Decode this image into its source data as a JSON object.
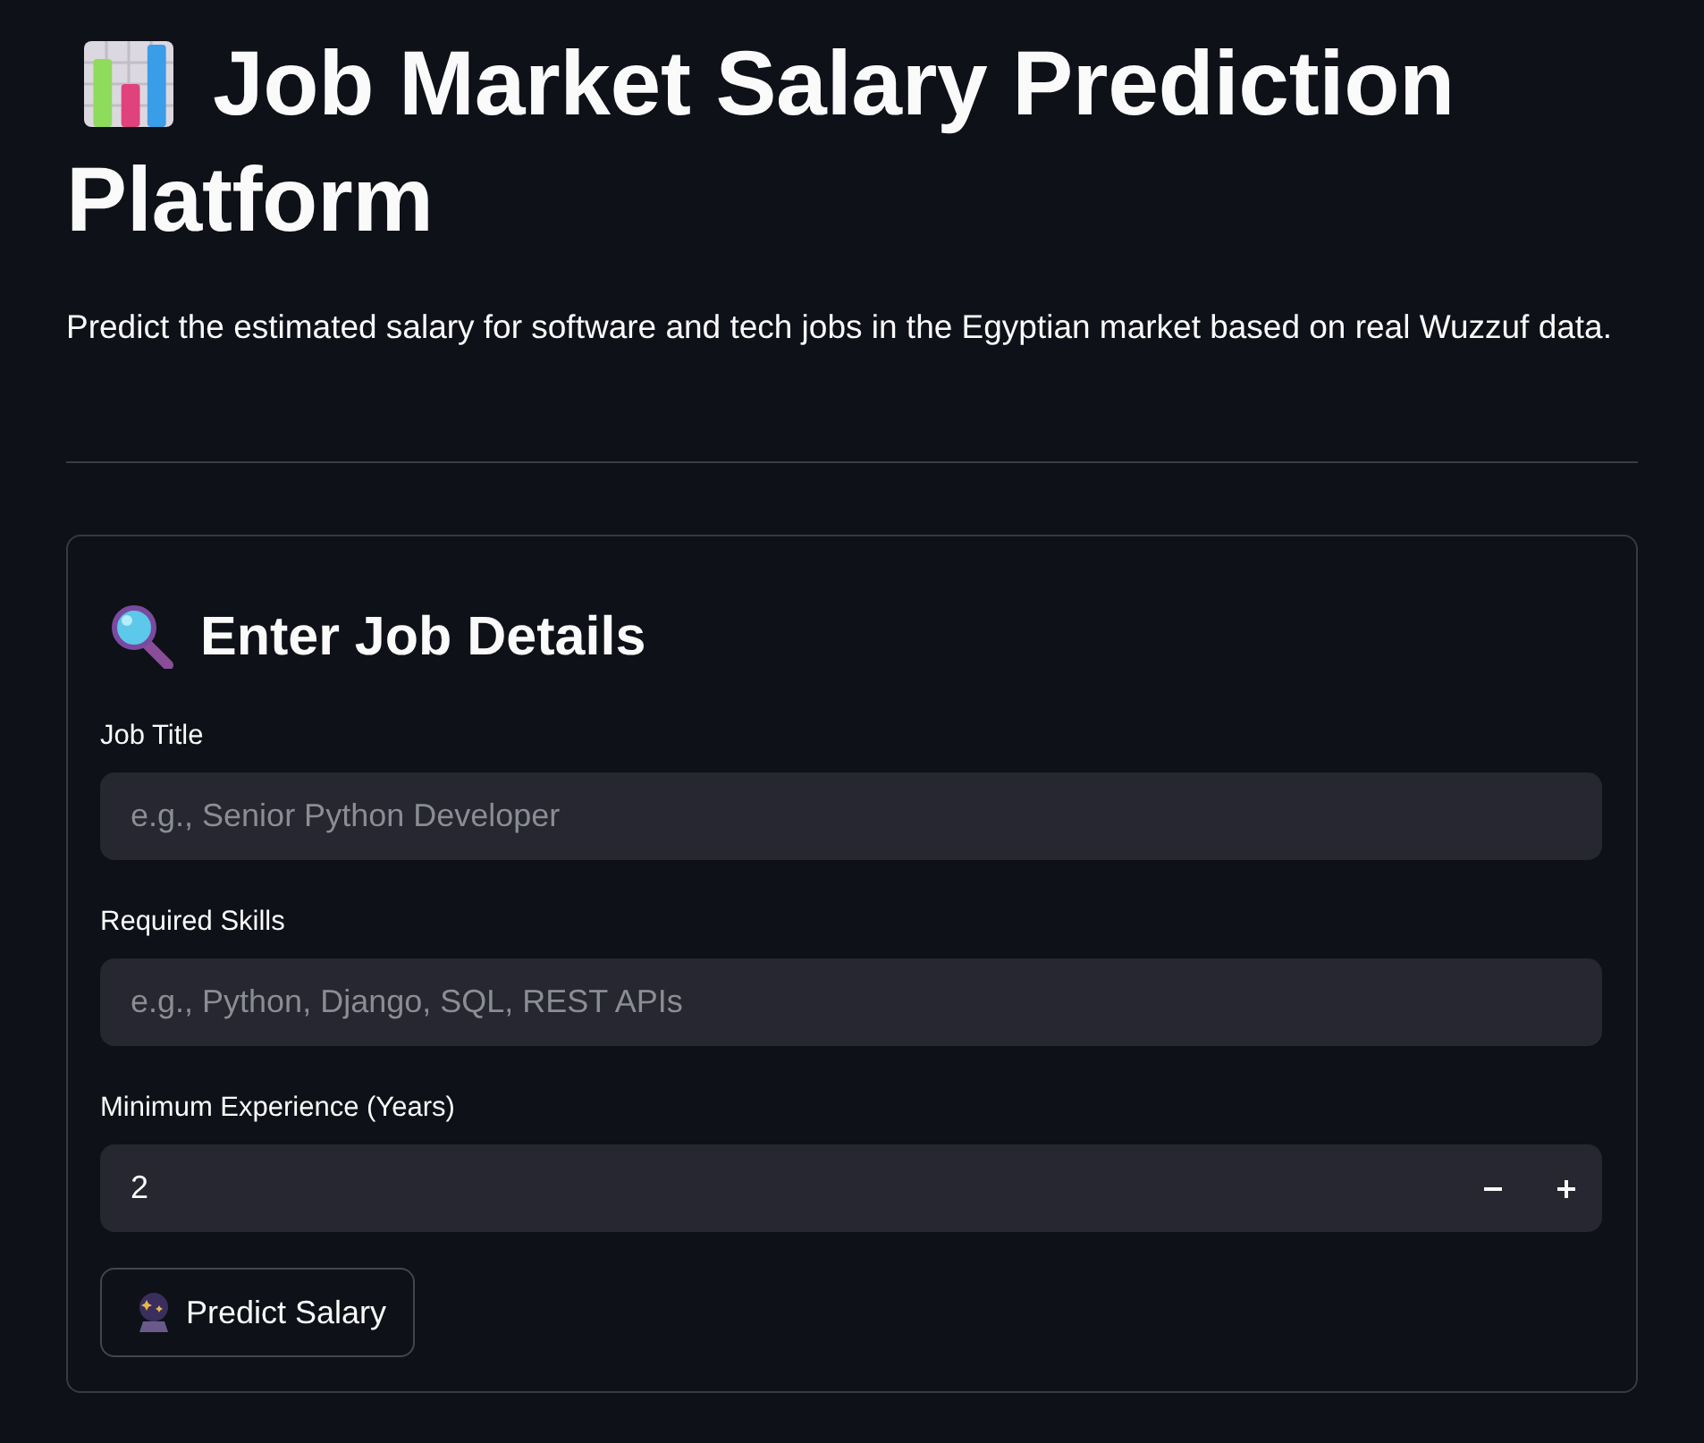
{
  "header": {
    "title_lines": [
      "Job Market Salary Prediction",
      "Platform"
    ],
    "description": "Predict the estimated salary for software and tech jobs in the Egyptian market based on real Wuzzuf data."
  },
  "form": {
    "heading": "Enter Job Details",
    "fields": [
      {
        "kind": "text",
        "label": "Job Title",
        "placeholder": "e.g., Senior Python Developer"
      },
      {
        "kind": "text",
        "label": "Required Skills",
        "placeholder": "e.g., Python, Django, SQL, REST APIs"
      },
      {
        "kind": "number",
        "label": "Minimum Experience (Years)",
        "value": "2"
      }
    ],
    "submit_button": {
      "label": "Predict Salary"
    }
  }
}
